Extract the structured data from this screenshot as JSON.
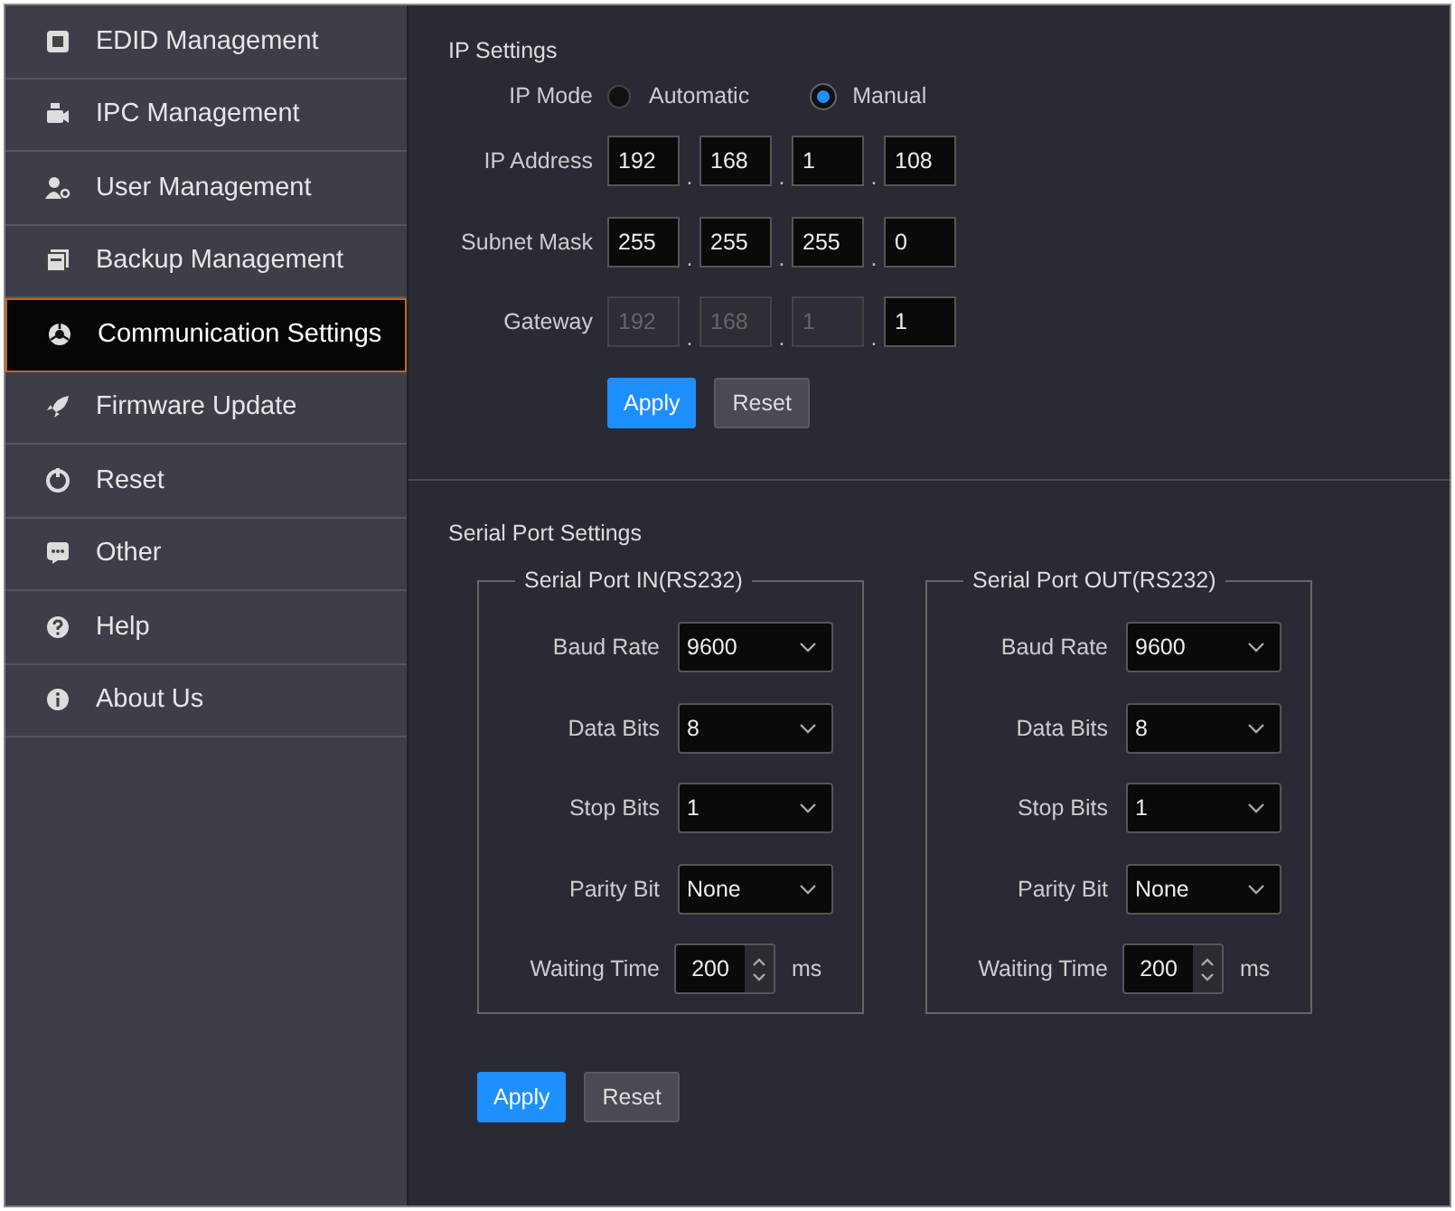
{
  "sidebar": {
    "items": [
      {
        "label": "EDID Management",
        "selected": false
      },
      {
        "label": "IPC Management",
        "selected": false
      },
      {
        "label": "User Management",
        "selected": false
      },
      {
        "label": "Backup Management",
        "selected": false
      },
      {
        "label": "Communication Settings",
        "selected": true
      },
      {
        "label": "Firmware Update",
        "selected": false
      },
      {
        "label": "Reset",
        "selected": false
      },
      {
        "label": "Other",
        "selected": false
      },
      {
        "label": "Help",
        "selected": false
      },
      {
        "label": "About Us",
        "selected": false
      }
    ]
  },
  "ip_settings": {
    "title": "IP Settings",
    "mode_label": "IP Mode",
    "modes": [
      {
        "label": "Automatic",
        "selected": false
      },
      {
        "label": "Manual",
        "selected": true
      }
    ],
    "fields": [
      {
        "label": "IP Address",
        "octets": [
          {
            "value": "192",
            "disabled": false
          },
          {
            "value": "168",
            "disabled": false
          },
          {
            "value": "1",
            "disabled": false
          },
          {
            "value": "108",
            "disabled": false
          }
        ]
      },
      {
        "label": "Subnet Mask",
        "octets": [
          {
            "value": "255",
            "disabled": false
          },
          {
            "value": "255",
            "disabled": false
          },
          {
            "value": "255",
            "disabled": false
          },
          {
            "value": "0",
            "disabled": false
          }
        ]
      },
      {
        "label": "Gateway",
        "octets": [
          {
            "value": "192",
            "disabled": true
          },
          {
            "value": "168",
            "disabled": true
          },
          {
            "value": "1",
            "disabled": true
          },
          {
            "value": "1",
            "disabled": false
          }
        ]
      }
    ],
    "separator": ".",
    "buttons": [
      {
        "label": "Apply",
        "kind": "primary"
      },
      {
        "label": "Reset",
        "kind": "secondary"
      }
    ]
  },
  "serial_settings": {
    "title": "Serial Port Settings",
    "ports": [
      {
        "legend": "Serial Port IN(RS232)",
        "rows": [
          {
            "kind": "select",
            "label": "Baud Rate",
            "value": "9600"
          },
          {
            "kind": "select",
            "label": "Data Bits",
            "value": "8"
          },
          {
            "kind": "select",
            "label": "Stop Bits",
            "value": "1"
          },
          {
            "kind": "select",
            "label": "Parity Bit",
            "value": "None"
          },
          {
            "kind": "spinner",
            "label": "Waiting Time",
            "value": "200",
            "unit": "ms"
          }
        ]
      },
      {
        "legend": "Serial Port OUT(RS232)",
        "rows": [
          {
            "kind": "select",
            "label": "Baud Rate",
            "value": "9600"
          },
          {
            "kind": "select",
            "label": "Data Bits",
            "value": "8"
          },
          {
            "kind": "select",
            "label": "Stop Bits",
            "value": "1"
          },
          {
            "kind": "select",
            "label": "Parity Bit",
            "value": "None"
          },
          {
            "kind": "spinner",
            "label": "Waiting Time",
            "value": "200",
            "unit": "ms"
          }
        ]
      }
    ],
    "buttons": [
      {
        "label": "Apply",
        "kind": "primary"
      },
      {
        "label": "Reset",
        "kind": "secondary"
      }
    ]
  }
}
